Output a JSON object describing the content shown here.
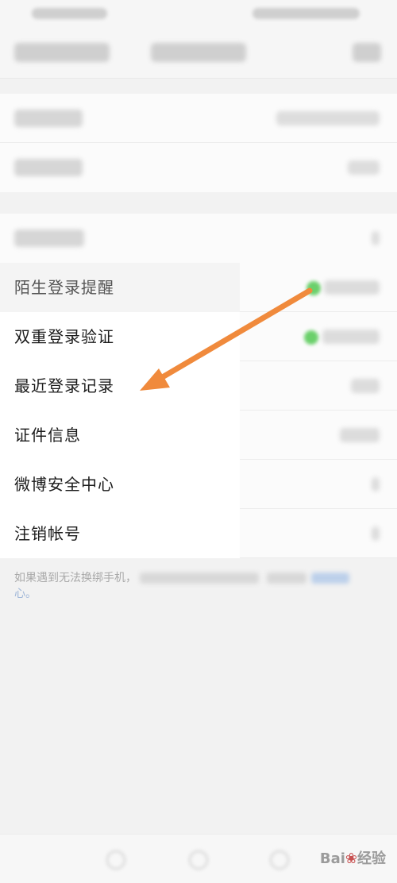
{
  "menu": {
    "items": [
      {
        "label": "陌生登录提醒"
      },
      {
        "label": "双重登录验证"
      },
      {
        "label": "最近登录记录"
      },
      {
        "label": "证件信息"
      },
      {
        "label": "微博安全中心"
      },
      {
        "label": "注销帐号"
      }
    ]
  },
  "footnote": {
    "visible_text": "如果遇到无法换绑手机，",
    "tail_text": "心。"
  },
  "colors": {
    "arrow": "#f08a3c",
    "toggle_on": "#6bd06b",
    "background": "#f2f2f2"
  },
  "watermark": {
    "text": "Bai",
    "paw_icon": "baidu-paw-icon",
    "suffix": "经验"
  }
}
